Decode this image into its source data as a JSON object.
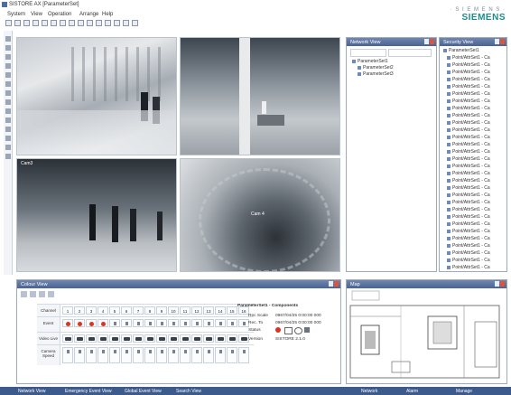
{
  "app": {
    "title": "SISTORE AX [ParameterSet]"
  },
  "brand": {
    "line1": "· S I E M E N S ·",
    "line2": "SIEMENS"
  },
  "menu": [
    "System",
    "View",
    "Operation",
    "Arrange",
    "Help"
  ],
  "toolbar_count": 15,
  "cameras": [
    {
      "name": "",
      "caption": ""
    },
    {
      "name": "",
      "caption": ""
    },
    {
      "name": "Cam3",
      "caption": ""
    },
    {
      "name": "",
      "caption": "Cam 4"
    }
  ],
  "network_view": {
    "title": "Network View",
    "root": "ParameterSet1",
    "children": [
      "ParameterSet2",
      "ParameterSet3"
    ]
  },
  "security_view": {
    "title": "Security View",
    "root": "ParameterSet1",
    "items": [
      "Point/AttrSet1 - Ca",
      "Point/AttrSet1 - Ca",
      "Point/AttrSet1 - Ca",
      "Point/AttrSet1 - Ca",
      "Point/AttrSet1 - Ca",
      "Point/AttrSet1 - Ca",
      "Point/AttrSet1 - Ca",
      "Point/AttrSet1 - Ca",
      "Point/AttrSet1 - Ca",
      "Point/AttrSet1 - Ca",
      "Point/AttrSet1 - Ca",
      "Point/AttrSet1 - Ca",
      "Point/AttrSet1 - Ca",
      "Point/AttrSet1 - Ca",
      "Point/AttrSet1 - Ca",
      "Point/AttrSet1 - Ca",
      "Point/AttrSet1 - Ca",
      "Point/AttrSet1 - Ca",
      "Point/AttrSet1 - Ca",
      "Point/AttrSet1 - Ca",
      "Point/AttrSet1 - Ca",
      "Point/AttrSet1 - Ca",
      "Point/AttrSet1 - Ca",
      "Point/AttrSet1 - Ca",
      "Point/AttrSet1 - Ca",
      "Point/AttrSet1 - Ca",
      "Point/AttrSet1 - Ca",
      "Point/AttrSet1 - Ca",
      "Point/AttrSet1 - Ca",
      "Point/AttrSet1 - Ca"
    ]
  },
  "colour_view": {
    "title": "Colour View",
    "row_labels": [
      "Channel",
      "Event",
      "Video Live",
      "Camera Speed"
    ],
    "channel_numbers": [
      "1",
      "2",
      "3",
      "4",
      "5",
      "6",
      "7",
      "8",
      "9",
      "10",
      "11",
      "12",
      "13",
      "14",
      "15",
      "16"
    ],
    "event_icons": [
      1,
      1,
      1,
      1,
      0,
      0,
      0,
      0,
      0,
      0,
      0,
      0,
      0,
      0,
      0,
      0
    ],
    "event_red": [
      1,
      1,
      1,
      1,
      0,
      0,
      0,
      0,
      0,
      0,
      0,
      0,
      0,
      0,
      0,
      0
    ],
    "video_live": [
      1,
      1,
      1,
      1,
      1,
      1,
      1,
      1,
      1,
      1,
      1,
      1,
      1,
      1,
      1,
      1
    ]
  },
  "info_block": {
    "heading": "ParameterSet1 - Components",
    "rows": [
      {
        "label": "Rec Scale",
        "value": "0967/04/25 0:00:00 000"
      },
      {
        "label": "Rec. To",
        "value": "0967/04/25 0:00:00 000"
      },
      {
        "label": "Status",
        "value": ""
      },
      {
        "label": "Version",
        "value": "SISTORE 2.1.0"
      }
    ]
  },
  "map_view": {
    "title": "Map"
  },
  "statusbar": {
    "left_items": [
      "Network View",
      "Emergency Event View",
      "Global Event View",
      "Search View"
    ],
    "right_items": [
      "",
      "Network",
      "Alarm",
      "Manage"
    ]
  }
}
